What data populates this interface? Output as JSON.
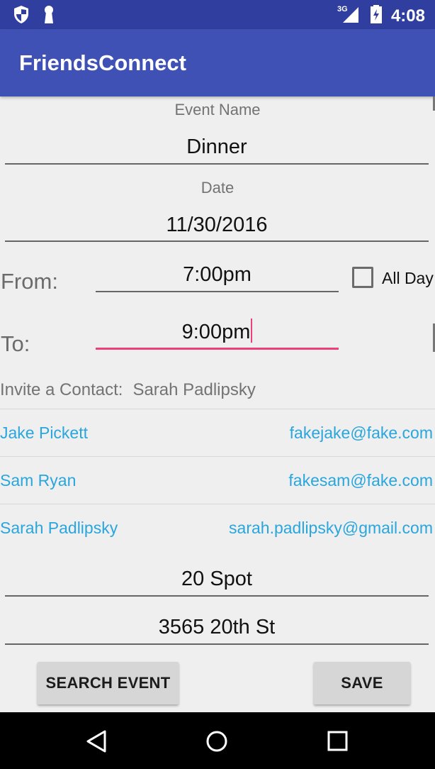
{
  "status_bar": {
    "time": "4:08",
    "network": "3G",
    "icons": [
      "shield-icon",
      "keyhole-icon",
      "signal-icon",
      "battery-icon"
    ]
  },
  "app_bar": {
    "title": "FriendsConnect"
  },
  "form": {
    "event_name_label": "Event Name",
    "event_name_value": "Dinner",
    "date_label": "Date",
    "date_value": "11/30/2016",
    "from_label": "From:",
    "from_value": "7:00pm",
    "to_label": "To:",
    "to_value": "9:00pm",
    "all_day_label": "All Day",
    "all_day_checked": false
  },
  "invite": {
    "label": "Invite a Contact:",
    "selected_contact": "Sarah Padlipsky"
  },
  "contacts": [
    {
      "name": "Jake Pickett",
      "email": "fakejake@fake.com"
    },
    {
      "name": "Sam Ryan",
      "email": "fakesam@fake.com"
    },
    {
      "name": "Sarah Padlipsky",
      "email": "sarah.padlipsky@gmail.com"
    }
  ],
  "location": {
    "place": "20 Spot",
    "address": "3565 20th St"
  },
  "buttons": {
    "search_event": "SEARCH EVENT",
    "save": "SAVE"
  },
  "colors": {
    "status_bar": "#303f9f",
    "app_bar": "#3f51b5",
    "accent": "#ec407a",
    "link": "#29a6dd"
  }
}
